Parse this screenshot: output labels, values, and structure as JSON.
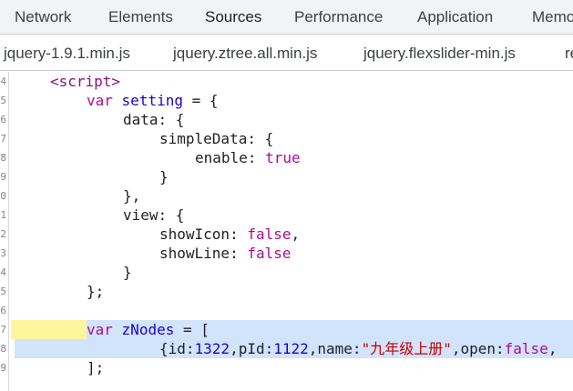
{
  "devtools_tabs": [
    {
      "label": "Network",
      "active": false
    },
    {
      "label": "Elements",
      "active": false
    },
    {
      "label": "Sources",
      "active": true
    },
    {
      "label": "Performance",
      "active": false
    },
    {
      "label": "Application",
      "active": false
    },
    {
      "label": "Memo",
      "active": false
    }
  ],
  "file_tabs": [
    {
      "label": "jquery-1.9.1.min.js",
      "active": false
    },
    {
      "label": "jquery.ztree.all.min.js",
      "active": false
    },
    {
      "label": "jquery.flexslider-min.js",
      "active": false
    },
    {
      "label": "re",
      "active": true
    }
  ],
  "line_numbers": [
    "4",
    "5",
    "6",
    "7",
    "8",
    "9",
    "0",
    "1",
    "2",
    "3",
    "4",
    "5",
    "6",
    "7",
    "8",
    "9"
  ],
  "code": {
    "l1": {
      "tag": "<script>"
    },
    "l2": {
      "kw": "var",
      "name": "setting",
      "rest": " = {"
    },
    "l3": {
      "text": "data: {"
    },
    "l4": {
      "text": "simpleData: {"
    },
    "l5": {
      "key": "enable: ",
      "val": "true"
    },
    "l6": {
      "text": "}"
    },
    "l7": {
      "text": "},"
    },
    "l8": {
      "text": "view: {"
    },
    "l9": {
      "key": "showIcon: ",
      "val": "false",
      "tail": ","
    },
    "l10": {
      "key": "showLine: ",
      "val": "false"
    },
    "l11": {
      "text": "}"
    },
    "l12": {
      "text": "};"
    },
    "l13": {
      "text": ""
    },
    "l14": {
      "kw": "var",
      "name": "zNodes",
      "rest": " = ["
    },
    "l15": {
      "p1": "{id:",
      "n1": "1322",
      "p2": ",pId:",
      "n2": "1122",
      "p3": ",name:",
      "s1": "\"九年级上册\"",
      "p4": ",open:",
      "b1": "false",
      "p5": ","
    },
    "l16": {
      "text": "];"
    }
  },
  "colors": {
    "accent": "#1a73e8",
    "selection": "#d2e3fc",
    "search_highlight": "#fff59d"
  }
}
